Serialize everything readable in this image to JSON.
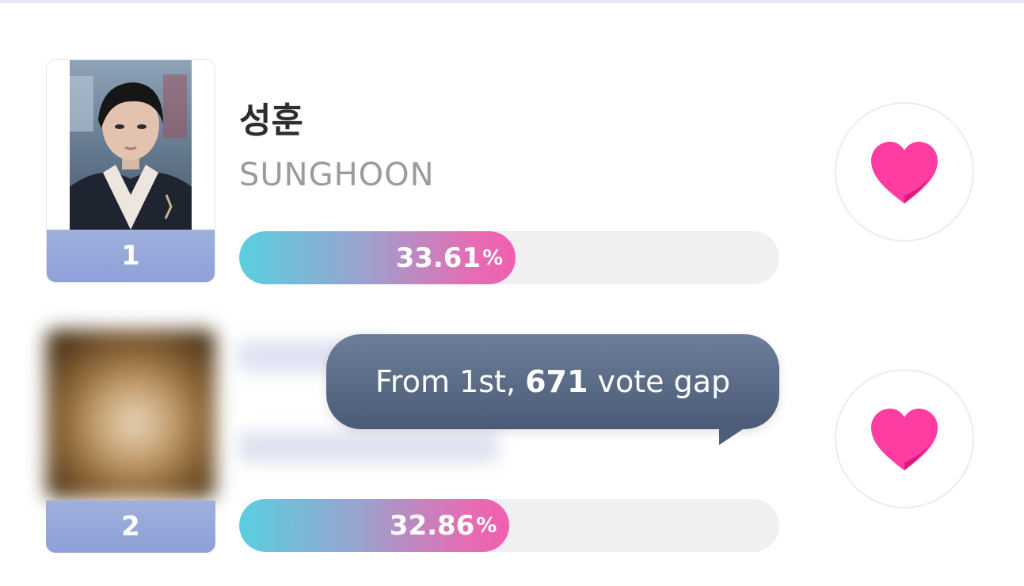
{
  "entries": [
    {
      "rank": "1",
      "name_ko": "성훈",
      "name_en": "SUNGHOON",
      "percent": "33.61",
      "percent_sign": "%",
      "percent_value": 33.61
    },
    {
      "rank": "2",
      "percent": "32.86",
      "percent_sign": "%",
      "percent_value": 32.86
    }
  ],
  "gap_tooltip": {
    "prefix": "From 1st, ",
    "gap_votes": "671",
    "suffix": " vote gap"
  },
  "icons": [
    "heart-icon"
  ],
  "colors": {
    "rank_box": "#8ea0d7",
    "bar_start": "#58cfe0",
    "bar_end": "#f05fae",
    "heart": "#ff2f9c",
    "tooltip_bg": "#4a5b76"
  }
}
